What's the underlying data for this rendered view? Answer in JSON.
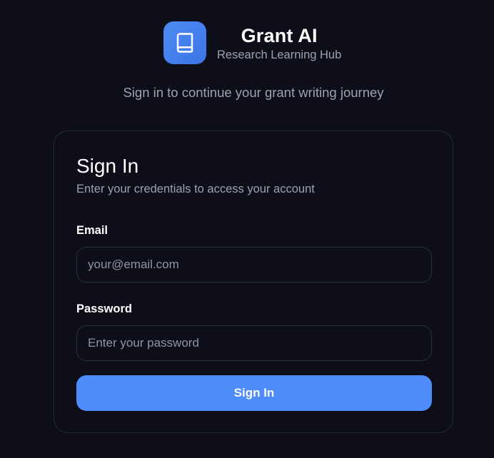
{
  "brand": {
    "title": "Grant AI",
    "subtitle": "Research Learning Hub",
    "logo_icon": "book-icon",
    "accent_color": "#4a86f2"
  },
  "tagline": "Sign in to continue your grant writing journey",
  "signin": {
    "title": "Sign In",
    "description": "Enter your credentials to access your account",
    "email": {
      "label": "Email",
      "placeholder": "your@email.com",
      "value": ""
    },
    "password": {
      "label": "Password",
      "placeholder": "Enter your password",
      "value": ""
    },
    "submit_label": "Sign In",
    "submit_color": "#4f8cfb"
  }
}
